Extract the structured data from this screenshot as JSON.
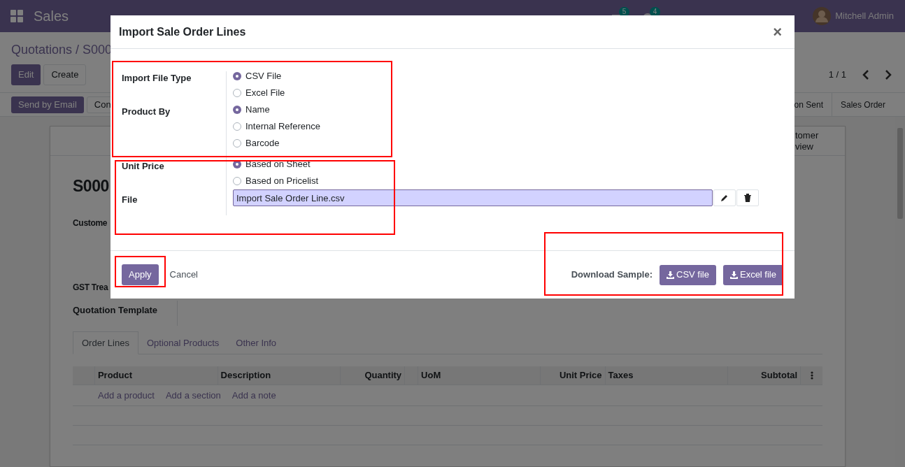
{
  "navbar": {
    "app": "Sales",
    "messages_count": "5",
    "activities_count": "4",
    "user": "Mitchell Admin"
  },
  "breadcrumb": "Quotations / S000",
  "actions": [
    "Edit",
    "Create"
  ],
  "pager": "1 / 1",
  "status_actions": [
    "Send by Email",
    "Con"
  ],
  "status_steps": [
    "on Sent",
    "Sales Order"
  ],
  "sheet": {
    "smart_button": [
      "tomer",
      "view"
    ],
    "name": "S000",
    "labels": [
      "Custome",
      "GST Trea"
    ],
    "template_label": "Quotation Template",
    "tabs": [
      {
        "label": "Order Lines",
        "selected": true
      },
      {
        "label": "Optional Products",
        "selected": false
      },
      {
        "label": "Other Info",
        "selected": false
      }
    ],
    "columns": [
      "Product",
      "Description",
      "Quantity",
      "UoM",
      "Unit Price",
      "Taxes",
      "Subtotal"
    ],
    "add_links": [
      "Add a product",
      "Add a section",
      "Add a note"
    ]
  },
  "dialog": {
    "title": "Import Sale Order Lines",
    "close": "×",
    "fields": [
      {
        "label": "Import File Type",
        "kind": "radio",
        "options": [
          {
            "label": "CSV File",
            "selected": true
          },
          {
            "label": "Excel File",
            "selected": false
          }
        ]
      },
      {
        "label": "Product By",
        "kind": "radio",
        "options": [
          {
            "label": "Name",
            "selected": true
          },
          {
            "label": "Internal Reference",
            "selected": false
          },
          {
            "label": "Barcode",
            "selected": false
          }
        ]
      },
      {
        "label": "Unit Price",
        "kind": "radio",
        "options": [
          {
            "label": "Based on Sheet",
            "selected": true
          },
          {
            "label": "Based on Pricelist",
            "selected": false
          }
        ]
      },
      {
        "label": "File",
        "kind": "file",
        "value": "Import Sale Order Line.csv"
      }
    ],
    "apply": "Apply",
    "cancel": "Cancel",
    "download_label": "Download Sample:",
    "download_buttons": [
      "CSV file",
      "Excel file"
    ]
  }
}
